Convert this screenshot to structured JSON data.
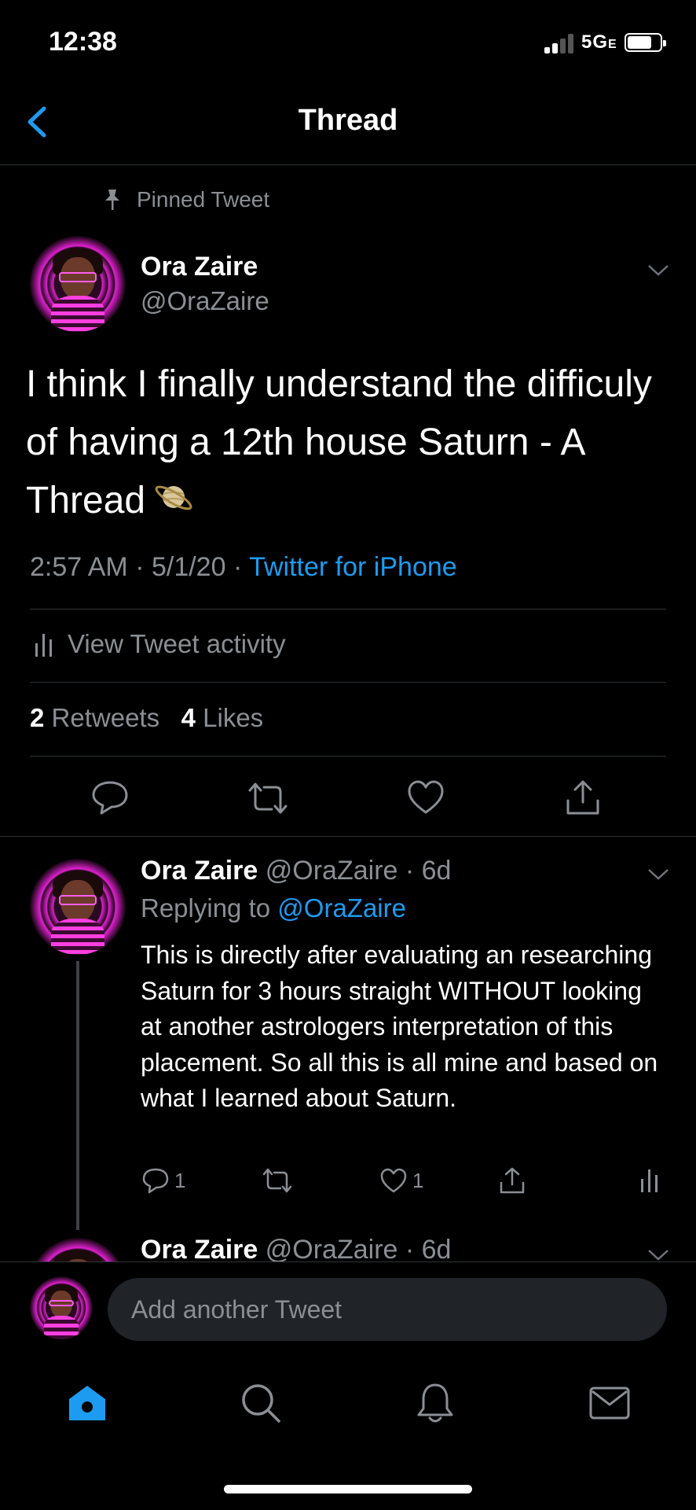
{
  "status_bar": {
    "time": "12:38",
    "network": "5G",
    "network_suffix": "E"
  },
  "nav": {
    "title": "Thread"
  },
  "main_tweet": {
    "pinned_label": "Pinned Tweet",
    "author_name": "Ora Zaire",
    "author_handle": "@OraZaire",
    "text": "I think I finally understand the difficuly of having a 12th house Saturn - A Thread",
    "emoji": "saturn",
    "time": "2:57 AM",
    "date": "5/1/20",
    "source": "Twitter for iPhone",
    "activity_label": "View Tweet activity",
    "retweet_count": "2",
    "retweet_label": "Retweets",
    "like_count": "4",
    "like_label": "Likes"
  },
  "reply": {
    "author_name": "Ora Zaire",
    "author_handle": "@OraZaire",
    "age": "6d",
    "replying_label": "Replying to",
    "replying_to": "@OraZaire",
    "text": "This is directly after evaluating an researching Saturn for 3 hours straight WITHOUT looking at another astrologers interpretation of this placement. So all this is all mine and based on what I learned about Saturn.",
    "reply_count": "1",
    "retweet_count": "",
    "like_count": "1"
  },
  "next_tweet": {
    "author_name": "Ora Zaire",
    "author_handle": "@OraZaire",
    "age": "6d"
  },
  "composer": {
    "placeholder": "Add another Tweet"
  },
  "tabs": [
    "home-icon",
    "search-icon",
    "notifications-icon",
    "messages-icon"
  ],
  "colors": {
    "accent": "#1d9bf0",
    "background": "#000000",
    "secondary_text": "#8b8f94"
  }
}
